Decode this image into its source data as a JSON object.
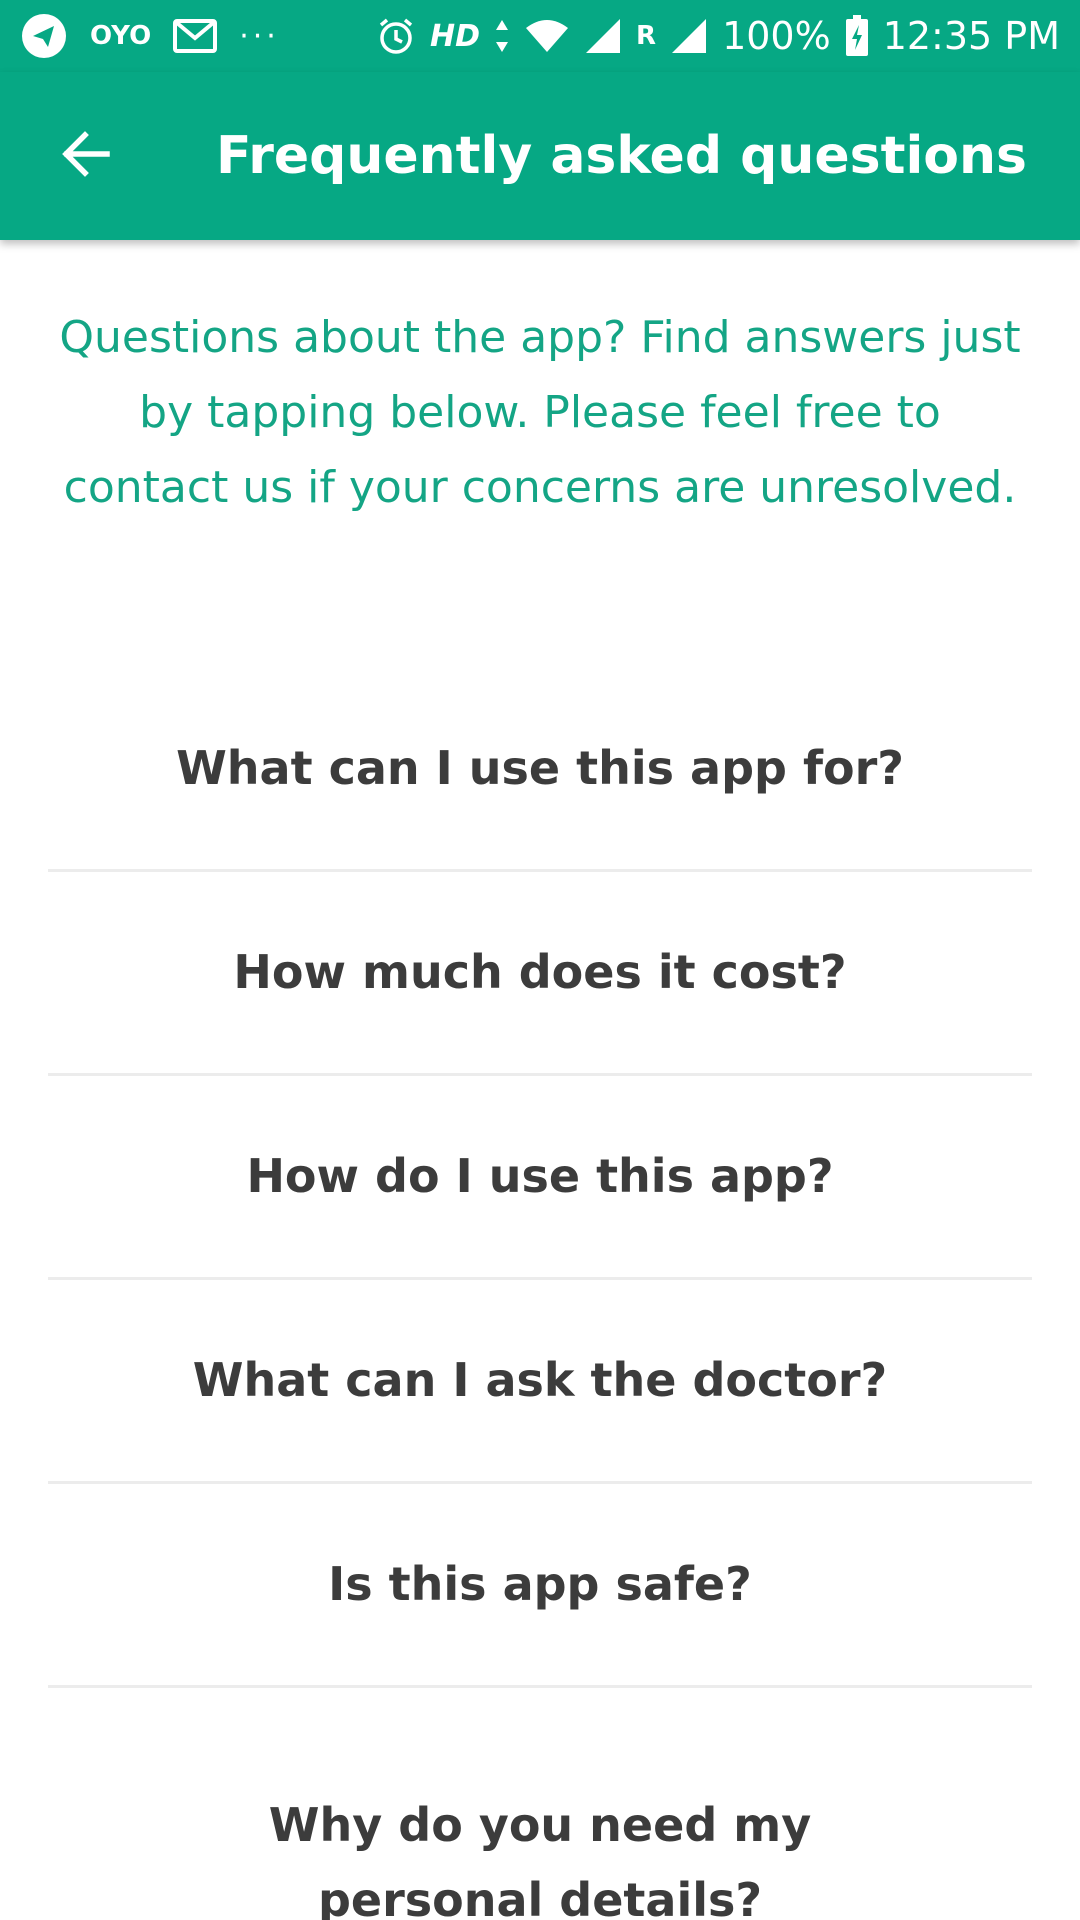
{
  "status_bar": {
    "icons": [
      "telegram-icon",
      "oyo-icon",
      "gmail-icon",
      "more-icon",
      "alarm-icon",
      "hd-icon",
      "data-arrows-icon",
      "wifi-icon",
      "signal-icon",
      "roaming-icon",
      "signal-icon",
      "battery-charging-icon"
    ],
    "oyo_label": "OYO",
    "hd_label": "HD",
    "roaming_label": "R",
    "battery": "100%",
    "time": "12:35 PM"
  },
  "app_bar": {
    "back_icon": "arrow-back-icon",
    "title": "Frequently asked questions"
  },
  "intro": {
    "text": "Questions about the app? Find answers just by tapping below. Please feel free to contact us if your concerns are unresolved."
  },
  "faq": {
    "items": [
      {
        "label": "What can I use this app for?"
      },
      {
        "label": "How much does it cost?"
      },
      {
        "label": "How do I use this app?"
      },
      {
        "label": "What can I ask the doctor?"
      },
      {
        "label": "Is this app safe?"
      },
      {
        "label": "Why do you need my personal details?"
      }
    ]
  },
  "colors": {
    "accent": "#06a884",
    "intro_text": "#14a585",
    "question_text": "#3c3c3c",
    "divider": "#ececec"
  }
}
